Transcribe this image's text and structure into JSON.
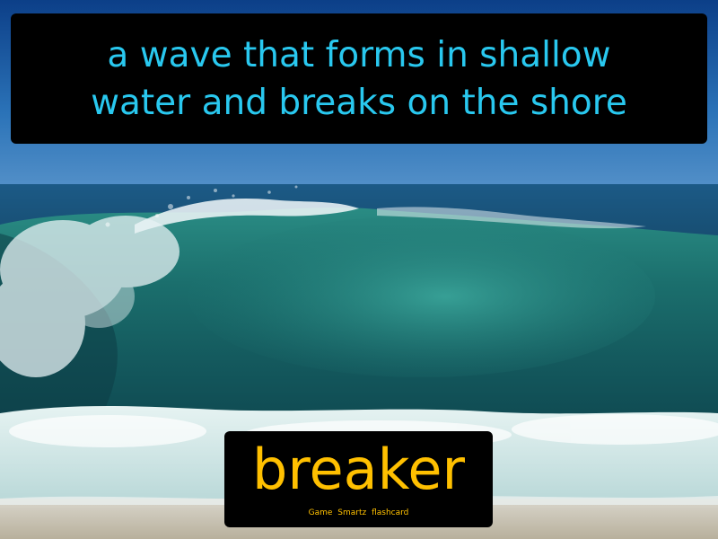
{
  "definition": {
    "line1": "a wave that forms in shallow",
    "line2": "water and breaks on the shore"
  },
  "term": "breaker",
  "credit": "Game Smartz flashcard",
  "photo": {
    "subject": "wave-photo",
    "colors": {
      "sky": "#1f5fa6",
      "ocean": "#0f4a6e",
      "wave_face": "#1a6e6a",
      "foam": "#e8f4f4",
      "sand": "#c9c2b0"
    }
  },
  "colors": {
    "definition_text": "#29c8ef",
    "term_text": "#ffc000",
    "box_background": "#000000"
  }
}
